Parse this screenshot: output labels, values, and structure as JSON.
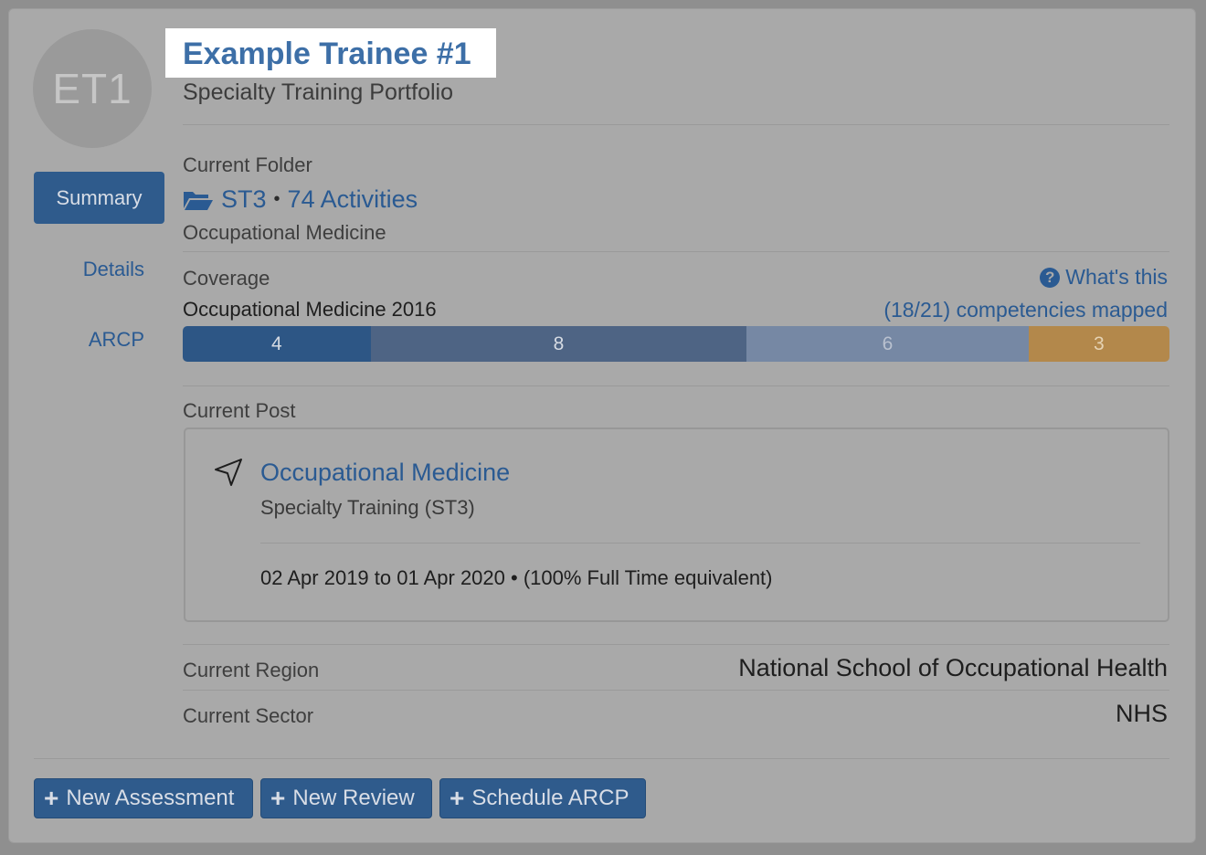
{
  "profile": {
    "initials": "ET1",
    "name": "Example Trainee #1",
    "subtitle": "Specialty Training Portfolio"
  },
  "nav": {
    "summary": "Summary",
    "details": "Details",
    "arcp": "ARCP"
  },
  "folder": {
    "label": "Current Folder",
    "stage": "ST3",
    "separator": "•",
    "activities": "74 Activities",
    "specialty": "Occupational Medicine"
  },
  "coverage": {
    "label": "Coverage",
    "help_link": "What's this",
    "curriculum": "Occupational Medicine 2016",
    "mapped": "(18/21) competencies mapped",
    "segments": [
      {
        "value": "4",
        "count": 4,
        "color": "#2d5685"
      },
      {
        "value": "8",
        "count": 8,
        "color": "#4e6484"
      },
      {
        "value": "6",
        "count": 6,
        "color": "#7688a4"
      },
      {
        "value": "3",
        "count": 3,
        "color": "#b3884b"
      }
    ]
  },
  "post": {
    "label": "Current Post",
    "title": "Occupational Medicine",
    "subtitle": "Specialty Training (ST3)",
    "dates": "02 Apr 2019 to 01 Apr 2020 • (100% Full Time equivalent)"
  },
  "region": {
    "label": "Current Region",
    "value": "National School of Occupational Health"
  },
  "sector": {
    "label": "Current Sector",
    "value": "NHS"
  },
  "actions": {
    "new_assessment": "New Assessment",
    "new_review": "New Review",
    "schedule_arcp": "Schedule ARCP"
  }
}
